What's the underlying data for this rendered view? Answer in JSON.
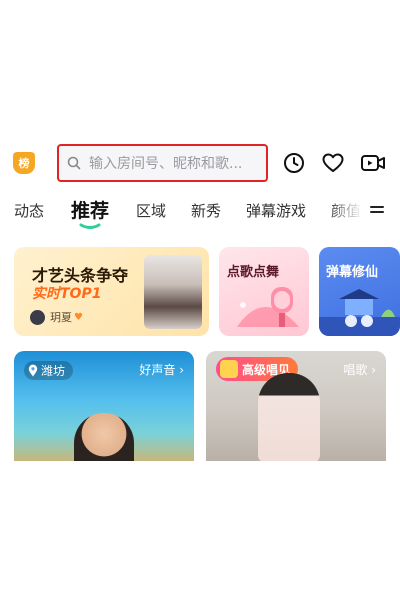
{
  "header": {
    "rank_badge": "榜",
    "search_placeholder": "输入房间号、昵称和歌...",
    "icons": [
      "history-clock-icon",
      "heart-icon",
      "start-live-video-icon"
    ]
  },
  "tabs": [
    {
      "label": "动态",
      "active": false
    },
    {
      "label": "推荐",
      "active": true
    },
    {
      "label": "区域",
      "active": false
    },
    {
      "label": "新秀",
      "active": false
    },
    {
      "label": "弹幕游戏",
      "active": false
    },
    {
      "label": "颜值",
      "active": false
    }
  ],
  "featured": [
    {
      "title": "才艺头条争夺",
      "subtitle": "实时TOP1",
      "user": "玥夏"
    },
    {
      "title": "点歌点舞"
    },
    {
      "title": "弹幕修仙"
    }
  ],
  "streams": [
    {
      "location": "潍坊",
      "category": "好声音 ›"
    },
    {
      "badge": "高级唱见",
      "category": "唱歌 ›"
    }
  ],
  "colors": {
    "accent_green": "#2ecf9a",
    "search_highlight": "#e02424",
    "rank_badge": "#f5a623"
  }
}
